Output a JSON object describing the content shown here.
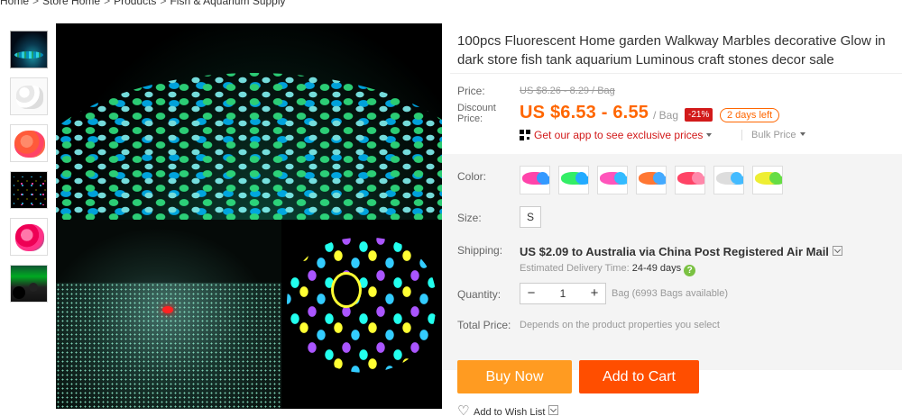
{
  "breadcrumb": [
    "Home",
    "Store Home",
    "Products",
    "Fish & Aquarium Supply"
  ],
  "breadcrumb_sep": ">",
  "product": {
    "title": "100pcs Fluorescent Home garden Walkway Marbles decorative Glow in dark store fish tank aquarium Luminous craft stones decor sale"
  },
  "price": {
    "label": "Price:",
    "original": "US $8.26 - 8.29 / Bag",
    "discount_label": "Discount Price:",
    "discount": "US $6.53 - 6.55",
    "unit": "/ Bag",
    "off_badge": "-21%",
    "days_left": "2 days left",
    "app_promo": "Get our app to see exclusive prices",
    "bulk": "Bulk Price"
  },
  "options": {
    "color_label": "Color:",
    "color_swatches": [
      {
        "name": "pink-blue",
        "c1": "#f4a",
        "c2": "#39f"
      },
      {
        "name": "green-blue",
        "c1": "#3e6",
        "c2": "#2af"
      },
      {
        "name": "pink-blue-2",
        "c1": "#f5b",
        "c2": "#3bf"
      },
      {
        "name": "orange-blue",
        "c1": "#f73",
        "c2": "#4af"
      },
      {
        "name": "pink-red",
        "c1": "#f46",
        "c2": "#f8a"
      },
      {
        "name": "white-blue",
        "c1": "#ddd",
        "c2": "#4bf"
      },
      {
        "name": "yellow-green",
        "c1": "#ee3",
        "c2": "#6d4"
      }
    ],
    "size_label": "Size:",
    "size_value": "S"
  },
  "shipping": {
    "label": "Shipping:",
    "text": "US $2.09 to Australia via China Post Registered Air Mail",
    "est_label": "Estimated Delivery Time:",
    "est_days": "24-49 days",
    "help": "?"
  },
  "quantity": {
    "label": "Quantity:",
    "minus": "−",
    "value": "1",
    "plus": "+",
    "available": "Bag (6993 Bags available)"
  },
  "total": {
    "label": "Total Price:",
    "text": "Depends on the product properties you select"
  },
  "actions": {
    "buy_now": "Buy Now",
    "add_to_cart": "Add to Cart",
    "wish_list": "Add to Wish List"
  },
  "colors": {
    "discount_price": "#ff6600",
    "off_badge_bg": "#d21a1a",
    "buy_now_bg": "#ff9b21",
    "add_to_cart_bg": "#ff4e00",
    "app_promo": "#d21a1a"
  }
}
